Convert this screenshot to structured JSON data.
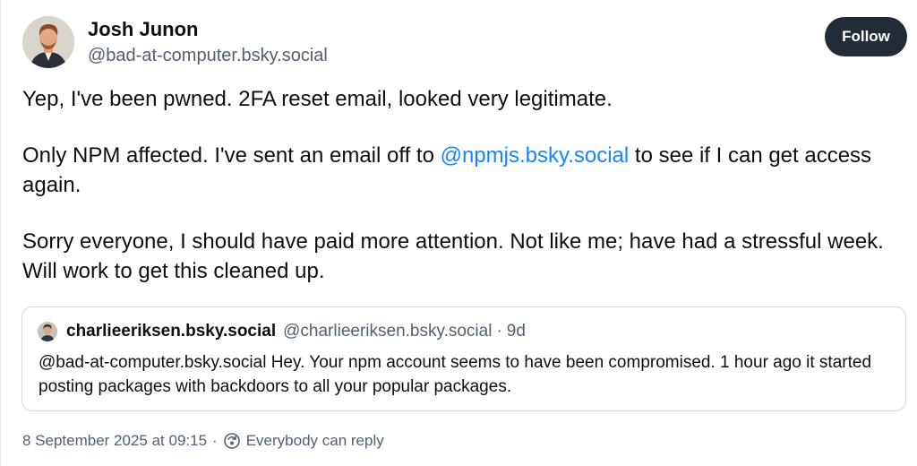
{
  "post": {
    "author": {
      "display_name": "Josh Junon",
      "handle": "@bad-at-computer.bsky.social",
      "avatar_icon": "avatar-portrait"
    },
    "follow_label": "Follow",
    "paragraphs": [
      {
        "text": "Yep, I've been pwned. 2FA reset email, looked very legitimate."
      },
      {
        "before": "Only NPM affected. I've sent an email off to ",
        "mention": "@npmjs.bsky.social",
        "after": " to see if I can get access again."
      },
      {
        "text": "Sorry everyone, I should have paid more attention. Not like me; have had a stressful week. Will work to get this cleaned up."
      }
    ],
    "quote": {
      "display_name": "charlieeriksen.bsky.social",
      "handle": "@charlieeriksen.bsky.social",
      "separator": "·",
      "age": "9d",
      "text": "@bad-at-computer.bsky.social Hey. Your npm account seems to have been compromised. 1 hour ago it started posting packages with backdoors to all your popular packages."
    },
    "footer": {
      "timestamp": "8 September 2025 at 09:15",
      "separator": "·",
      "reply_setting": "Everybody can reply",
      "reply_icon": "reply-settings-icon"
    }
  },
  "colors": {
    "link": "#1a83ff",
    "button_bg": "#222b36",
    "secondary_text": "#53606f",
    "border": "#d4d9e1"
  }
}
